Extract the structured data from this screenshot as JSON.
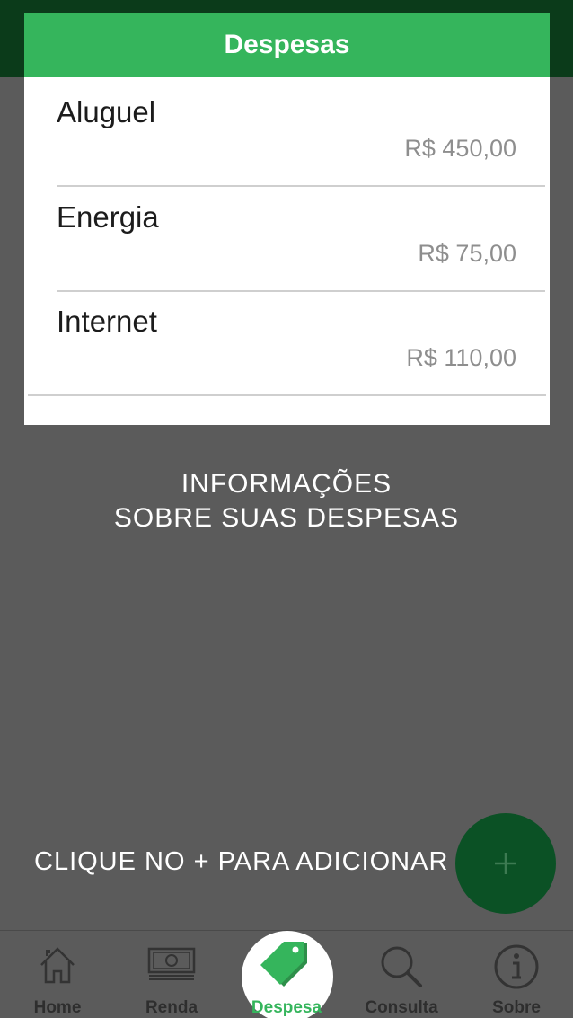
{
  "header": {
    "title": "Despesas"
  },
  "expenses": [
    {
      "name": "Aluguel",
      "value": "R$ 450,00"
    },
    {
      "name": "Energia",
      "value": "R$ 75,00"
    },
    {
      "name": "Internet",
      "value": "R$ 110,00"
    }
  ],
  "info": {
    "line1": "INFORMAÇÕES",
    "line2": "SOBRE SUAS DESPESAS"
  },
  "hint": "CLIQUE NO + PARA ADICIONAR",
  "fab": {
    "icon": "plus-icon"
  },
  "nav": [
    {
      "label": "Home",
      "icon": "home-icon"
    },
    {
      "label": "Renda",
      "icon": "banknote-icon"
    },
    {
      "label": "Despesa",
      "icon": "price-tag-icon",
      "active": true
    },
    {
      "label": "Consulta",
      "icon": "search-icon"
    },
    {
      "label": "Sobre",
      "icon": "info-icon"
    }
  ],
  "colors": {
    "accent": "#35b55c",
    "dark_green": "#0b5125",
    "overlay": "#5b5b5b"
  }
}
